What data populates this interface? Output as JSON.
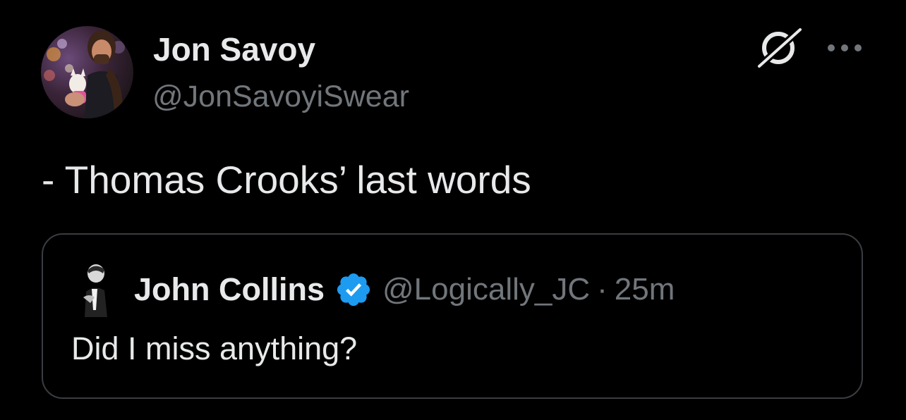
{
  "tweet": {
    "author": {
      "name": "Jon Savoy",
      "handle": "@JonSavoyiSwear",
      "avatar_icon": "profile-photo"
    },
    "text": "- Thomas Crooks’ last words",
    "actions": {
      "grok_icon": "grok-icon",
      "more_icon": "more-icon"
    },
    "quoted": {
      "name": "John Collins",
      "verified": true,
      "handle": "@Logically_JC",
      "separator": "·",
      "time": "25m",
      "text": "Did I miss anything?"
    }
  },
  "colors": {
    "background": "#000000",
    "primary_text": "#e7e9ea",
    "secondary_text": "#71767b",
    "card_border": "#3a3d41",
    "verified_blue": "#1d9bf0"
  }
}
